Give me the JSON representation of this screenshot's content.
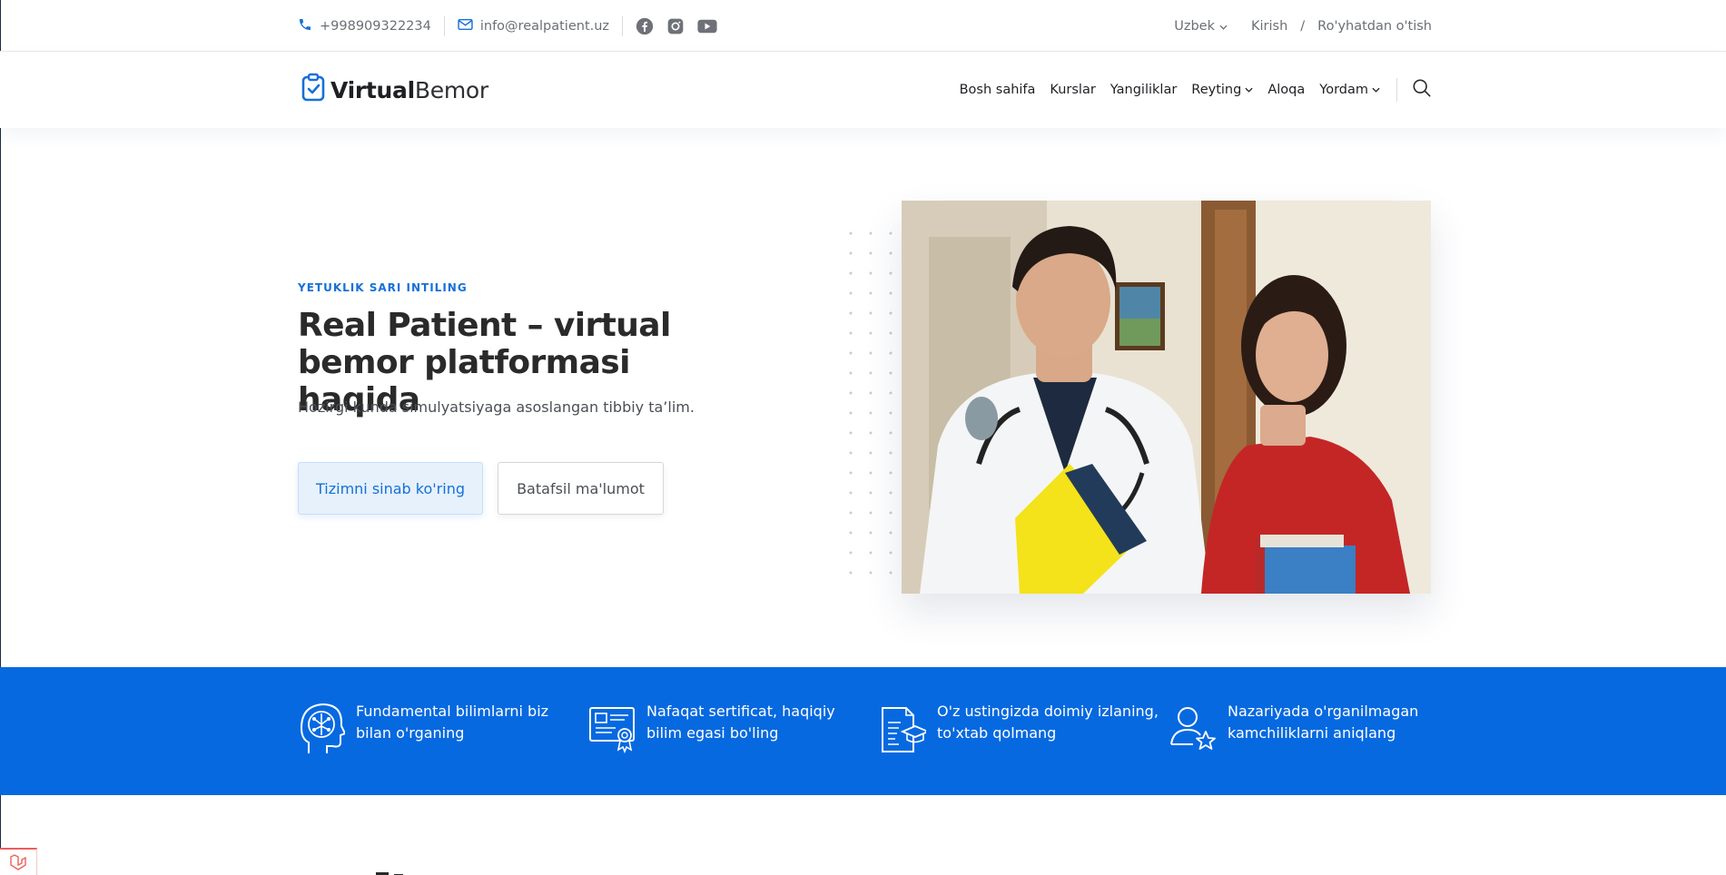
{
  "topbar": {
    "phone": "+998909322234",
    "email": "info@realpatient.uz",
    "social_icons": [
      "facebook-icon",
      "instagram-icon",
      "youtube-icon"
    ],
    "language": "Uzbek",
    "login": "Kirish",
    "separator": "/",
    "register": "Ro'yhatdan o'tish"
  },
  "header": {
    "logo_bold": "Virtual",
    "logo_light": "Bemor",
    "nav": [
      {
        "label": "Bosh sahifa",
        "dropdown": false
      },
      {
        "label": "Kurslar",
        "dropdown": false
      },
      {
        "label": "Yangiliklar",
        "dropdown": false
      },
      {
        "label": "Reyting",
        "dropdown": true
      },
      {
        "label": "Aloqa",
        "dropdown": false
      },
      {
        "label": "Yordam",
        "dropdown": true
      }
    ]
  },
  "hero": {
    "eyebrow": "YETUKLIK SARI INTILING",
    "title": "Real Patient – virtual bemor platformasi haqida",
    "subtitle": "Hozirgi kunda simulyatsiyaga asoslangan tibbiy ta’lim.",
    "primary_button": "Tizimni sinab ko'ring",
    "secondary_button": "Batafsil ma'lumot"
  },
  "features": [
    {
      "icon": "brain-head-icon",
      "text_line1": "Fundamental bilimlarni biz",
      "text_line2": "bilan o'rganing"
    },
    {
      "icon": "certificate-icon",
      "text_line1": "Nafaqat sertificat, haqiqiy",
      "text_line2": "bilim egasi bo'ling"
    },
    {
      "icon": "document-graduation-icon",
      "text_line1": "O'z ustingizda doimiy izlaning,",
      "text_line2": "to'xtab qolmang"
    },
    {
      "icon": "user-star-icon",
      "text_line1": "Nazariyada o'rganilmagan",
      "text_line2": "kamchiliklarni aniqlang"
    }
  ],
  "colors": {
    "accent": "#1670d9",
    "band": "#0769e0",
    "text_dark": "#2a2a2a",
    "text_muted": "#6b6f76"
  }
}
